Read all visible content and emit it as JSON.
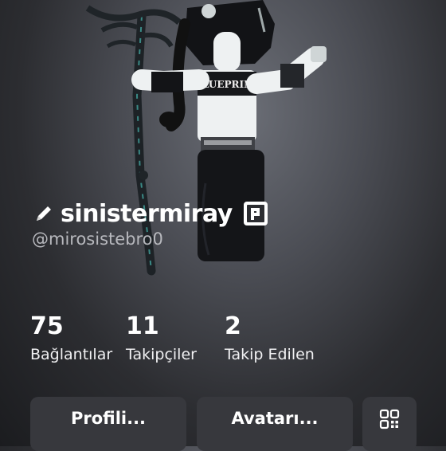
{
  "profile": {
    "display_name": "sinistermiray",
    "username": "@mirosistebro0",
    "avatar_shirt_text": "BLUEPRINT"
  },
  "stats": [
    {
      "value": "75",
      "label": "Bağlantılar"
    },
    {
      "value": "11",
      "label": "Takipçiler"
    },
    {
      "value": "2",
      "label": "Takip Edilen"
    }
  ],
  "actions": {
    "edit_profile_label": "Profili...",
    "avatar_label": "Avatarı..."
  },
  "icons": {
    "edit": "pencil-icon",
    "premium": "premium-badge-icon",
    "qr": "qr-code-icon"
  },
  "colors": {
    "background": "#2c2d31",
    "button": "#37383d",
    "username": "#b7b8bd"
  }
}
